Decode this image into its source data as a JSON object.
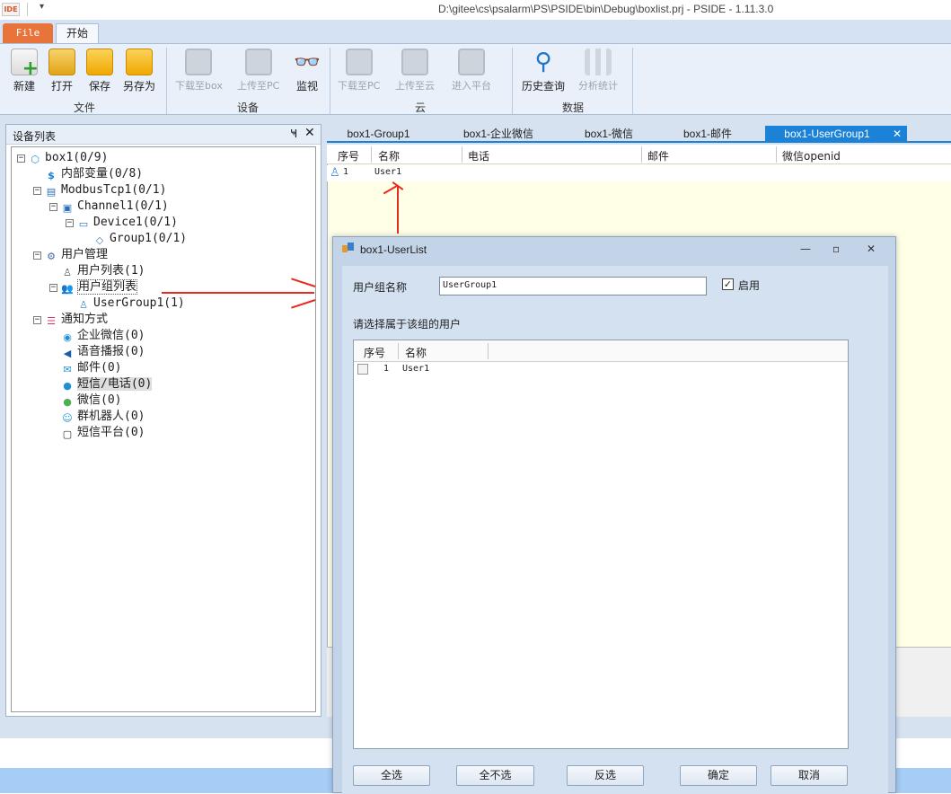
{
  "window": {
    "title": "D:\\gitee\\cs\\psalarm\\PS\\PSIDE\\bin\\Debug\\boxlist.prj - PSIDE - 1.11.3.0",
    "app_icon_text": "IDE",
    "qat_dropdown": "▾"
  },
  "ribbon": {
    "tabs": {
      "file": "File",
      "home": "开始"
    },
    "groups": {
      "file": {
        "label": "文件",
        "new": "新建",
        "open": "打开",
        "save": "保存",
        "save_as": "另存为"
      },
      "device": {
        "label": "设备",
        "download_box": "下载至box",
        "upload_pc": "上传至PC",
        "monitor": "监视"
      },
      "cloud": {
        "label": "云",
        "download_pc": "下载至PC",
        "upload_cloud": "上传至云",
        "enter_platform": "进入平台"
      },
      "data": {
        "label": "数据",
        "history": "历史查询",
        "analysis": "分析统计"
      }
    }
  },
  "device_panel": {
    "title": "设备列表",
    "pin": "Ҹ",
    "close": "✕",
    "tree": [
      {
        "label": "box1(0/9)"
      },
      {
        "label": "内部变量(0/8)",
        "icon": "$"
      },
      {
        "label": "ModbusTcp1(0/1)"
      },
      {
        "label": "Channel1(0/1)"
      },
      {
        "label": "Device1(0/1)"
      },
      {
        "label": "Group1(0/1)"
      },
      {
        "label": "用户管理"
      },
      {
        "label": "用户列表(1)"
      },
      {
        "label": "用户组列表"
      },
      {
        "label": "UserGroup1(1)"
      },
      {
        "label": "通知方式"
      },
      {
        "label": "企业微信(0)"
      },
      {
        "label": "语音播报(0)"
      },
      {
        "label": "邮件(0)"
      },
      {
        "label": "短信/电话(0)"
      },
      {
        "label": "微信(0)"
      },
      {
        "label": "群机器人(0)"
      },
      {
        "label": "短信平台(0)"
      }
    ]
  },
  "doc_tabs": [
    "box1-Group1",
    "box1-企业微信",
    "box1-微信",
    "box1-邮件",
    "box1-UserGroup1"
  ],
  "doc_tab_close": "✕",
  "grid": {
    "headers": [
      "序号",
      "名称",
      "电话",
      "邮件",
      "微信openid"
    ],
    "rows": [
      {
        "index": "1",
        "name": "User1"
      }
    ]
  },
  "dialog": {
    "title": "box1-UserList",
    "minimize": "—",
    "maximize": "▫",
    "close": "✕",
    "group_name_label": "用户组名称",
    "group_name_value": "UserGroup1",
    "enable_label": "启用",
    "enable_check": "✓",
    "select_users_label": "请选择属于该组的用户",
    "headers": [
      "序号",
      "名称"
    ],
    "rows": [
      {
        "index": "1",
        "name": "User1"
      }
    ],
    "buttons": {
      "select_all": "全选",
      "select_none": "全不选",
      "invert": "反选",
      "ok": "确定",
      "cancel": "取消"
    }
  },
  "colors": {
    "accent": "#1c82d8",
    "file_tab": "#e8743b",
    "annotation": "#e82b1e"
  }
}
